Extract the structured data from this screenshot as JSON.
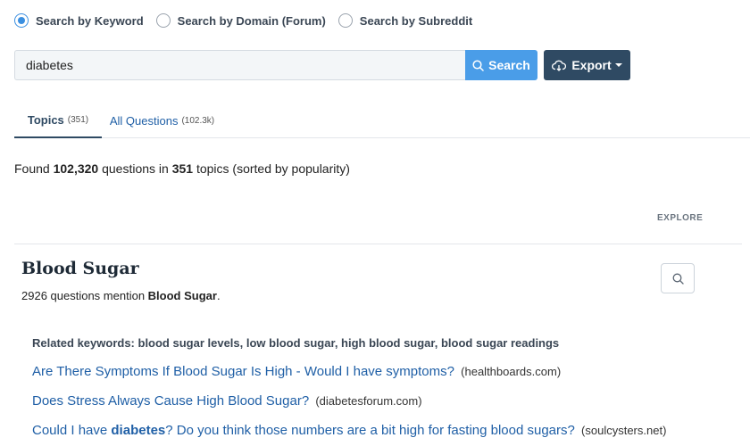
{
  "search_modes": [
    {
      "label": "Search by Keyword",
      "selected": true
    },
    {
      "label": "Search by Domain (Forum)",
      "selected": false
    },
    {
      "label": "Search by Subreddit",
      "selected": false
    }
  ],
  "search": {
    "value": "diabetes",
    "button_label": "Search",
    "export_label": "Export"
  },
  "tabs": [
    {
      "label": "Topics",
      "count": "(351)",
      "active": true
    },
    {
      "label": "All Questions",
      "count": "(102.3k)",
      "active": false
    }
  ],
  "summary": {
    "prefix": "Found",
    "questions_count": "102,320",
    "middle": "questions in",
    "topics_count": "351",
    "suffix": "topics (sorted by popularity)"
  },
  "explore_label": "EXPLORE",
  "topic": {
    "title": "Blood Sugar",
    "count_text": "2926 questions mention",
    "keyword": "Blood Sugar",
    "period": ".",
    "related_prefix": "Related keywords:",
    "related_keywords": "blood sugar levels, low blood sugar, high blood sugar, blood sugar readings"
  },
  "questions": [
    {
      "parts": [
        {
          "text": "Are There Symptoms If Blood Sugar Is High - Would I have symptoms?",
          "bold": false
        }
      ],
      "domain": "(healthboards.com)"
    },
    {
      "parts": [
        {
          "text": "Does Stress Always Cause High Blood Sugar?",
          "bold": false
        }
      ],
      "domain": "(diabetesforum.com)"
    },
    {
      "parts": [
        {
          "text": "Could I have ",
          "bold": false
        },
        {
          "text": "diabetes",
          "bold": true
        },
        {
          "text": "? Do you think those numbers are a bit high for fasting blood sugars?",
          "bold": false
        }
      ],
      "domain": "(soulcysters.net)"
    }
  ],
  "colors": {
    "accent": "#4a9de8",
    "dark_button": "#2f4a63",
    "link": "#1f5fa6"
  },
  "icons": {
    "search": "search-icon",
    "export": "cloud-download-icon",
    "explore": "magnifier-icon"
  }
}
